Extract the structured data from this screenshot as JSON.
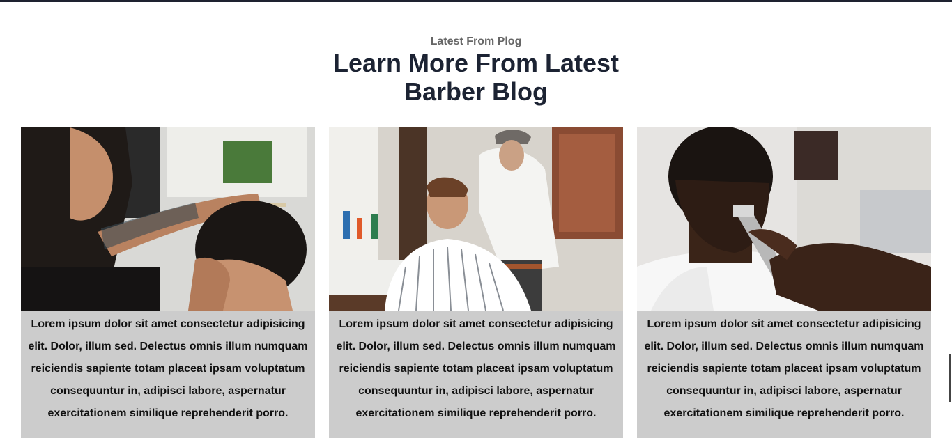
{
  "section": {
    "subtitle": "Latest From Plog",
    "heading_line1": "Learn More From Latest",
    "heading_line2": "Barber Blog"
  },
  "cards": [
    {
      "image": "barber-haircut-photo",
      "text": "Lorem ipsum dolor sit amet consectetur adipisicing elit. Dolor, illum sed. Delectus omnis illum numquam reiciendis sapiente totam placeat ipsam voluptatum consequuntur in, adipisci labore, aspernatur exercitationem similique reprehenderit porro."
    },
    {
      "image": "barber-styling-photo",
      "text": "Lorem ipsum dolor sit amet consectetur adipisicing elit. Dolor, illum sed. Delectus omnis illum numquam reiciendis sapiente totam placeat ipsam voluptatum consequuntur in, adipisci labore, aspernatur exercitationem similique reprehenderit porro."
    },
    {
      "image": "barber-clipper-photo",
      "text": "Lorem ipsum dolor sit amet consectetur adipisicing elit. Dolor, illum sed. Delectus omnis illum numquam reiciendis sapiente totam placeat ipsam voluptatum consequuntur in, adipisci labore, aspernatur exercitationem similique reprehenderit porro."
    }
  ],
  "colors": {
    "heading": "#1c2333",
    "subtitle": "#666666",
    "card_background": "#cccccc",
    "top_border": "#1e2230"
  }
}
